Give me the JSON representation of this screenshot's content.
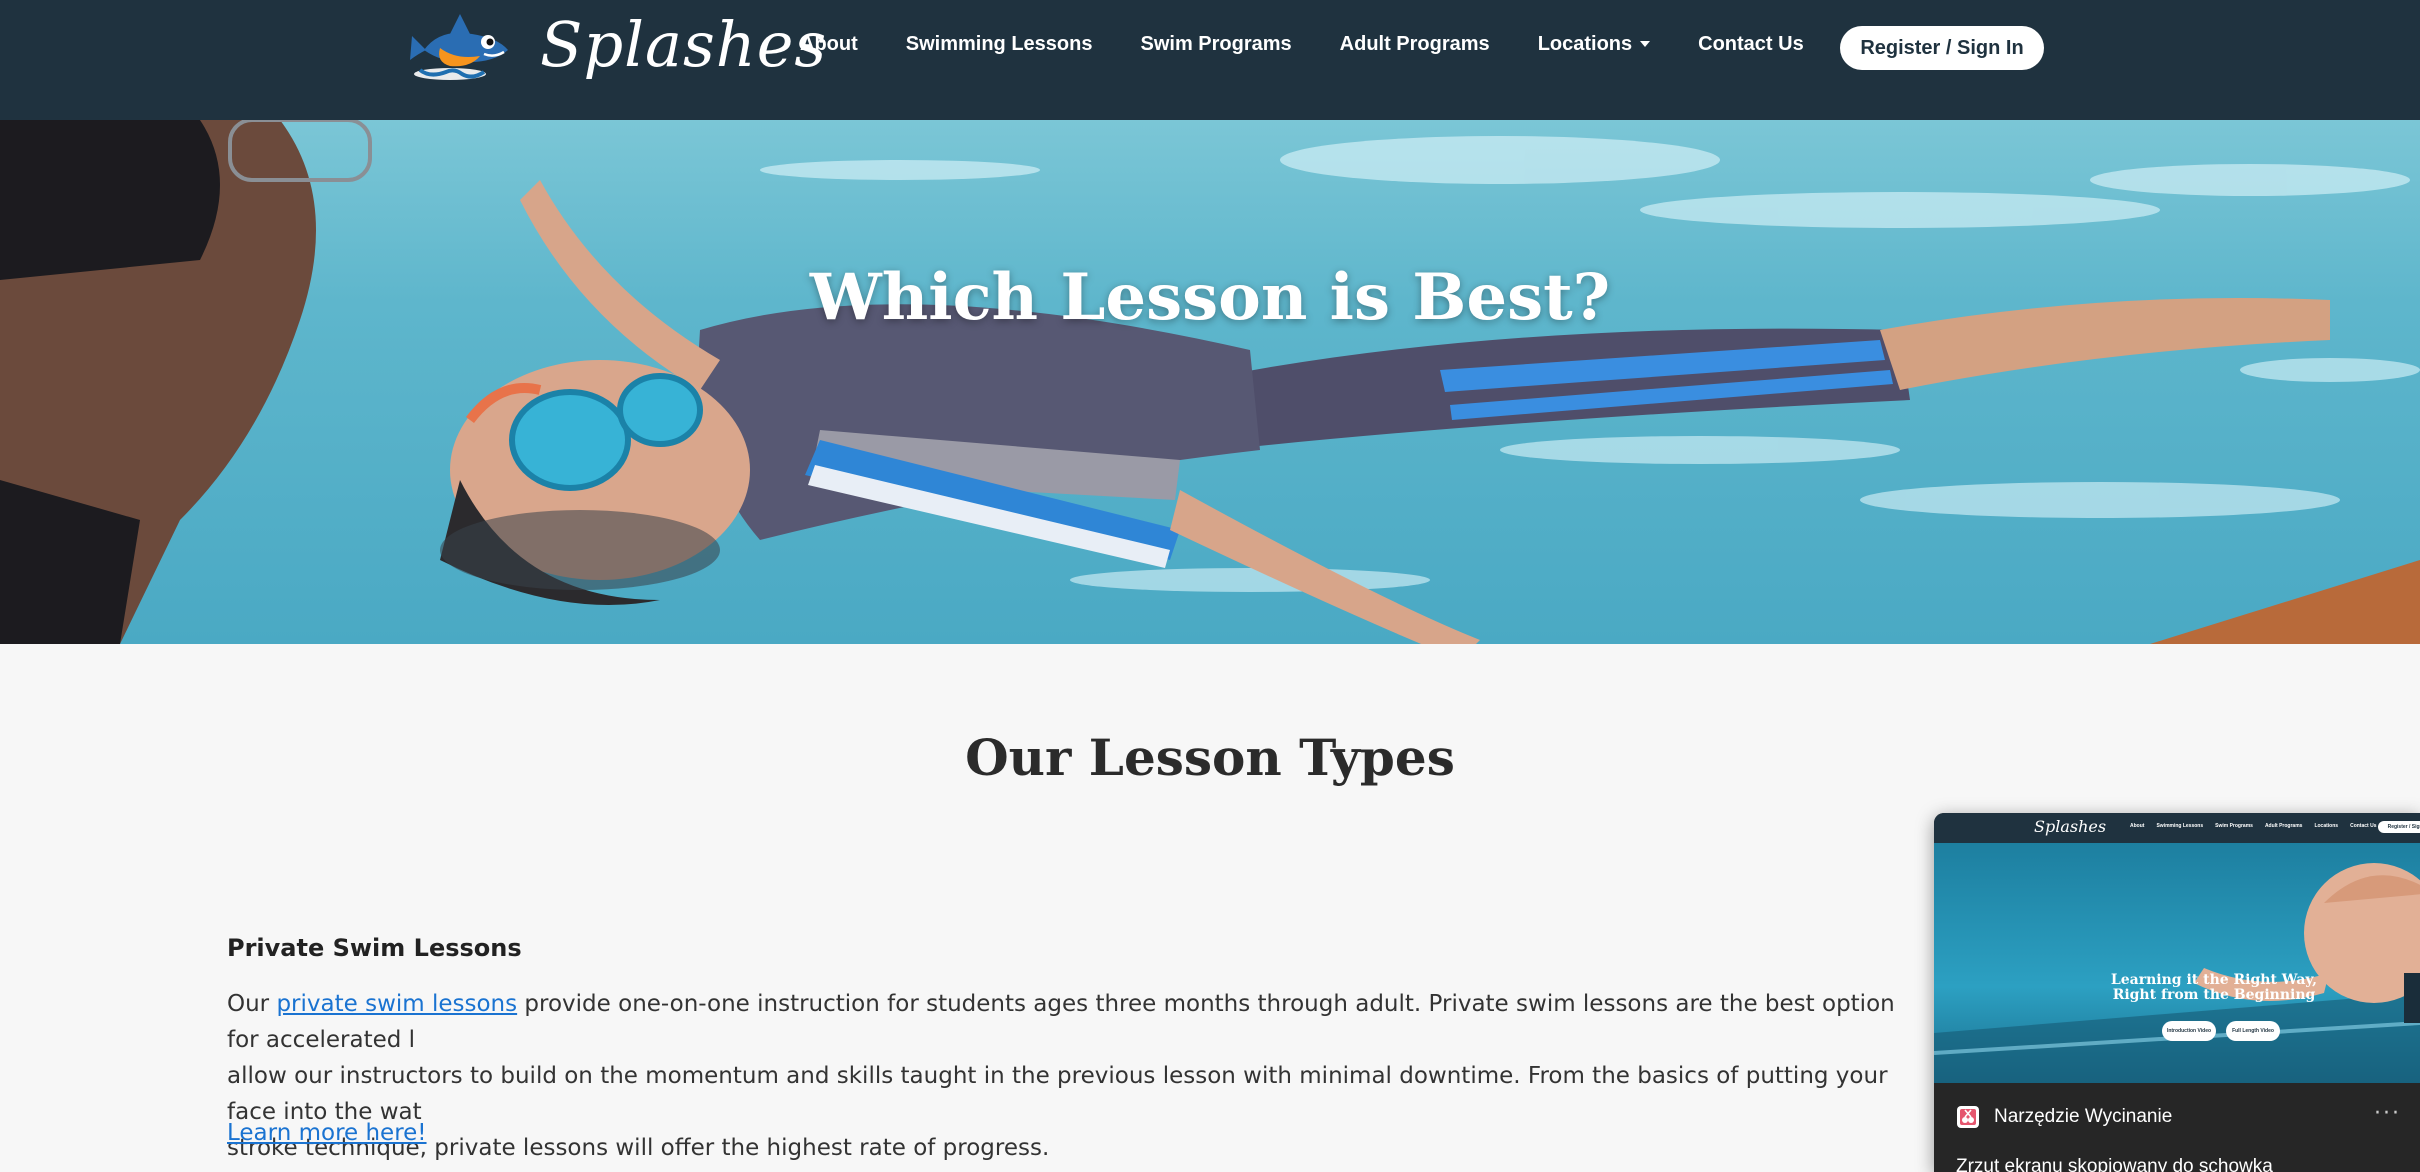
{
  "header": {
    "brand": "Splashes",
    "nav": [
      {
        "label": "About",
        "dropdown": false
      },
      {
        "label": "Swimming Lessons",
        "dropdown": false
      },
      {
        "label": "Swim Programs",
        "dropdown": false
      },
      {
        "label": "Adult Programs",
        "dropdown": false
      },
      {
        "label": "Locations",
        "dropdown": true
      },
      {
        "label": "Contact Us",
        "dropdown": false
      }
    ],
    "register_label": "Register / Sign In"
  },
  "hero": {
    "title": "Which Lesson is Best?"
  },
  "main": {
    "section_title": "Our Lesson Types",
    "lesson": {
      "title": "Private Swim Lessons",
      "body_prefix": "Our ",
      "body_link": "private swim lessons",
      "body_line1": " provide one-on-one instruction for students ages three months through adult. Private swim lessons are the best option for accelerated l",
      "body_line2": "allow our instructors to build on the momentum and skills taught in the previous lesson with minimal downtime. From the basics of putting your face into the wat",
      "body_line3": "stroke technique, private lessons will offer the highest rate of progress.",
      "learn_more": "Learn more here!"
    }
  },
  "snipping_tool": {
    "preview": {
      "brand": "Splashes",
      "nav": [
        "About",
        "Swimming Lessons",
        "Swim Programs",
        "Adult Programs",
        "Locations",
        "Contact Us"
      ],
      "register_label": "Register / Sign In",
      "hero_title_line1": "Learning it the Right Way,",
      "hero_title_line2": "Right from the Beginning",
      "hero_buttons": [
        "Introduction Video",
        "Full Length Video"
      ]
    },
    "app_name": "Narzędzie Wycinanie",
    "more": "···",
    "message": "Zrzut ekranu skopiowany do schowka"
  },
  "colors": {
    "header_bg": "#1f323f",
    "link": "#1a73d1",
    "page_bg": "#f7f7f7",
    "popup_bg": "#262626"
  }
}
